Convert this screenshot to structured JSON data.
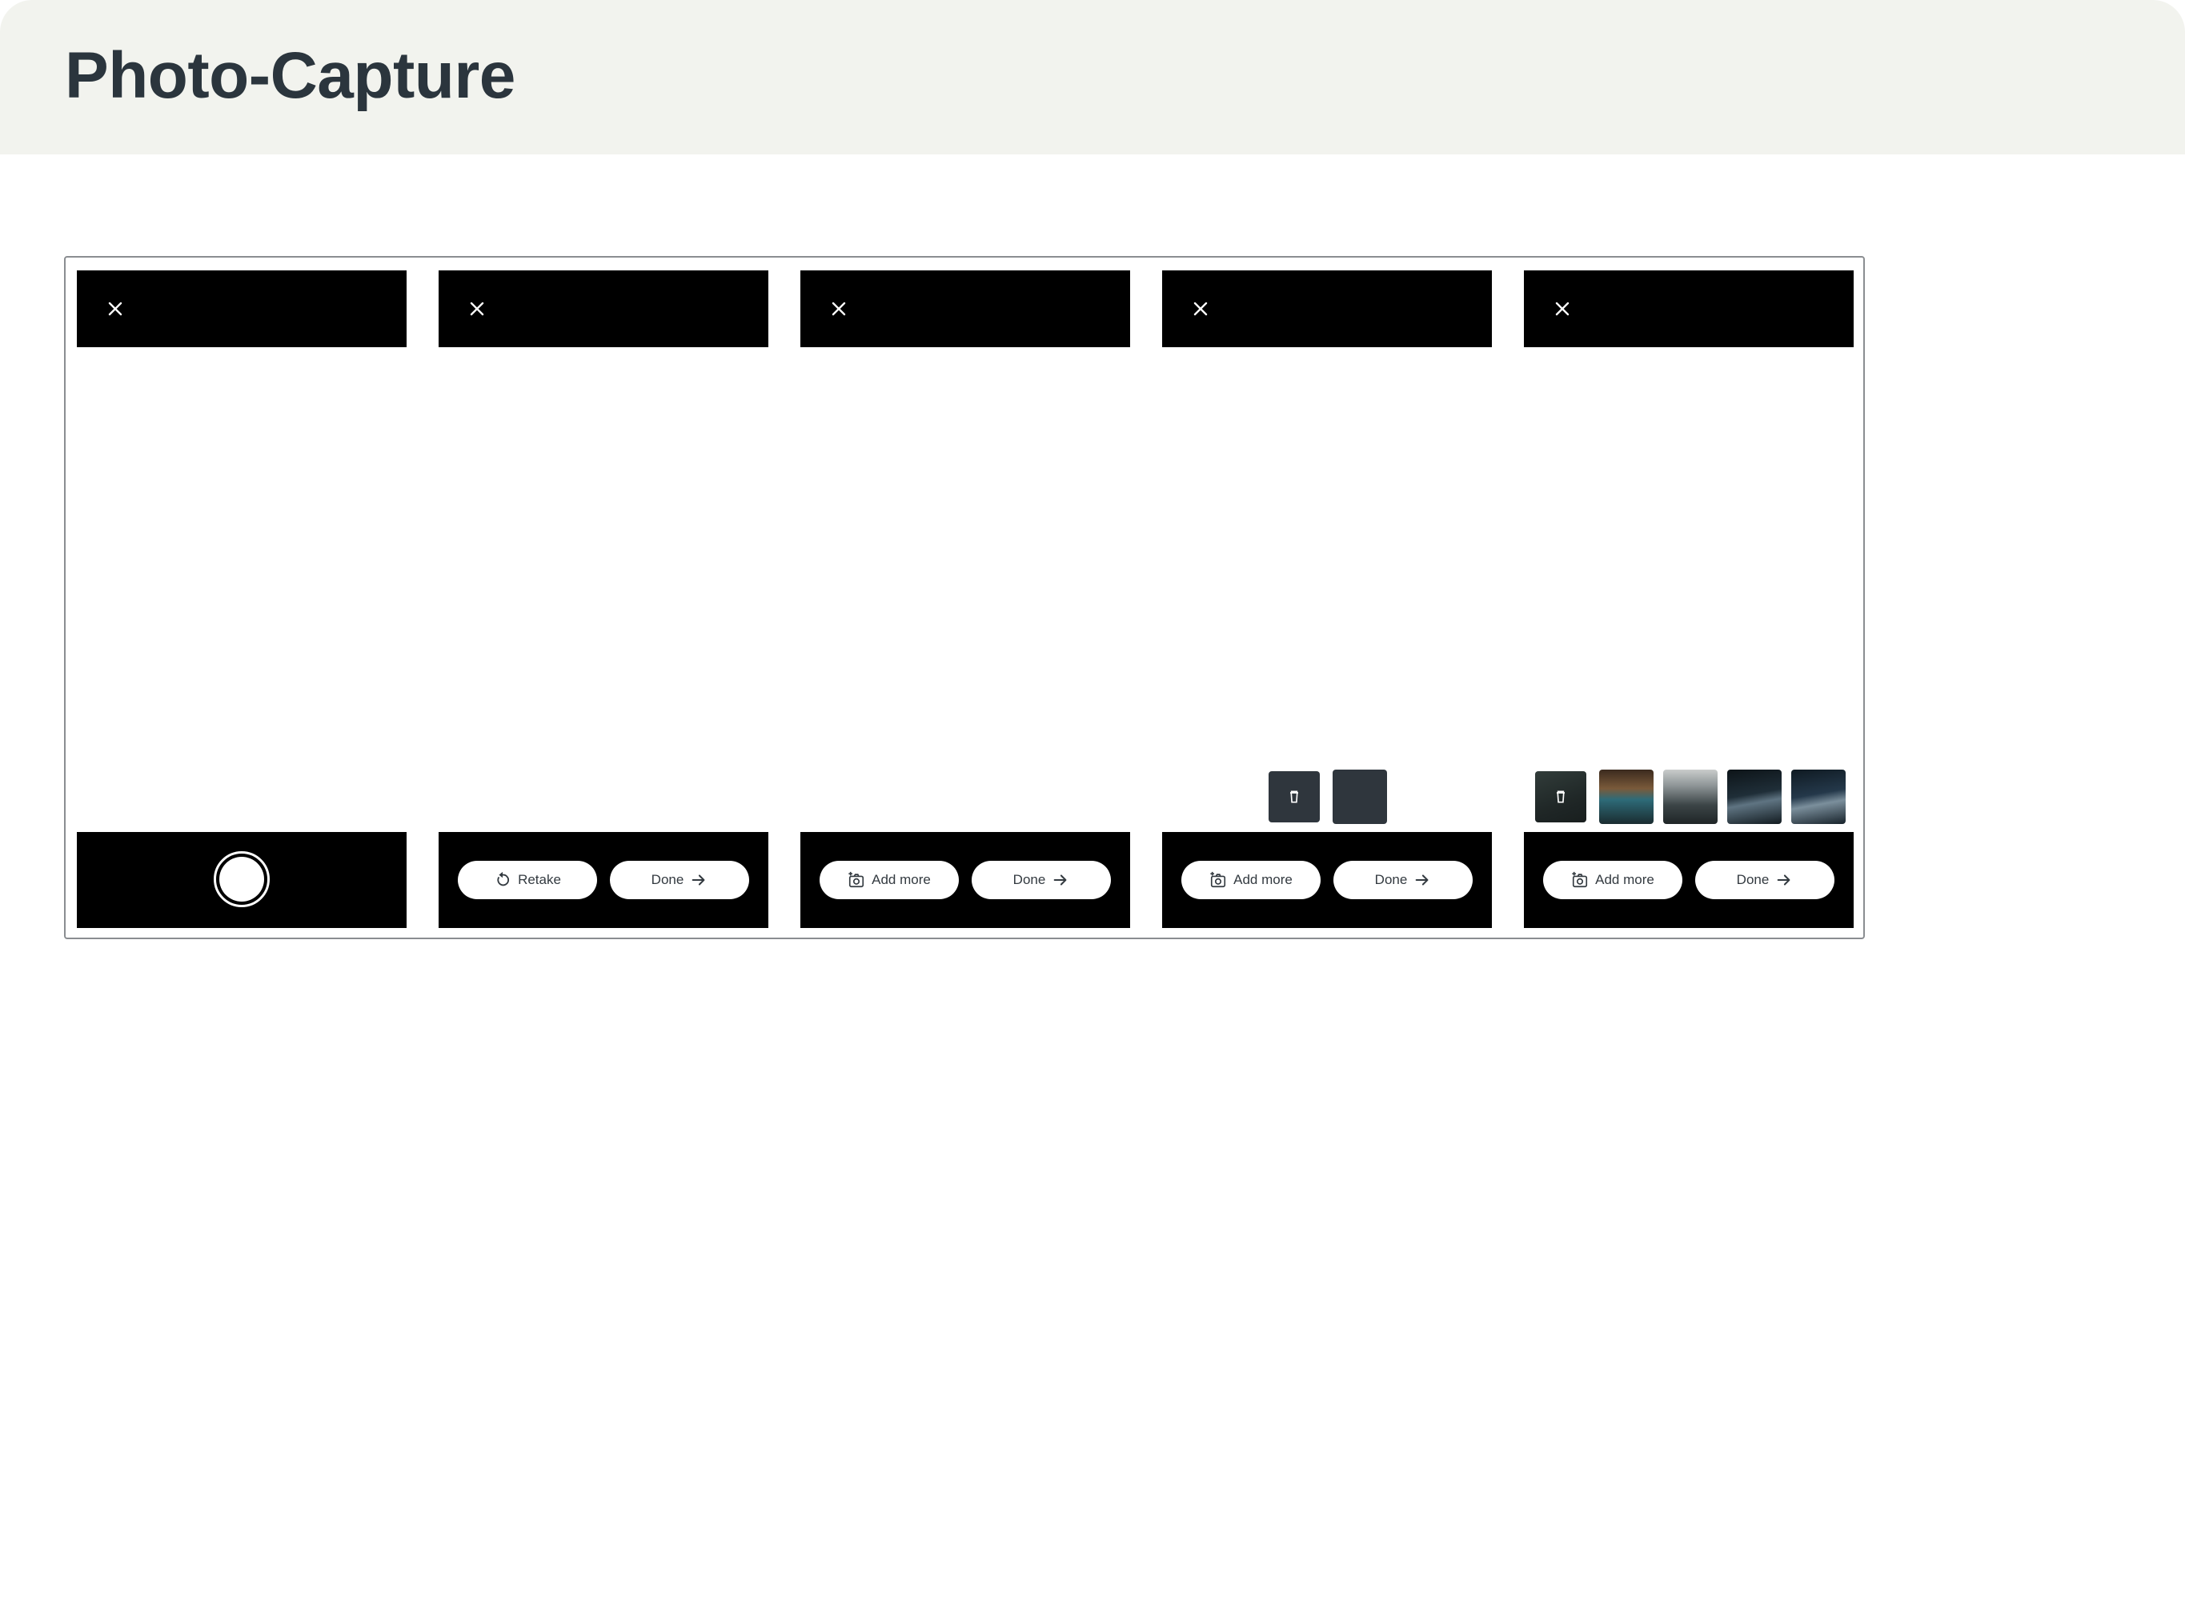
{
  "header": {
    "title": "Photo-Capture"
  },
  "colors": {
    "header_bg": "#f2f3ee",
    "bar_bg": "#000000",
    "pill_bg": "#ffffff",
    "thumb_placeholder": "#2f363d",
    "title_text": "#2b353d"
  },
  "screens": [
    {
      "close_icon": "close-icon",
      "control": "shutter-button"
    },
    {
      "close_icon": "close-icon",
      "left_label": "Retake",
      "left_icon": "retake-icon",
      "right_label": "Done",
      "right_icon": "arrow-right-icon"
    },
    {
      "close_icon": "close-icon",
      "left_label": "Add more",
      "left_icon": "add-photo-icon",
      "right_label": "Done",
      "right_icon": "arrow-right-icon"
    },
    {
      "close_icon": "close-icon",
      "left_label": "Add more",
      "left_icon": "add-photo-icon",
      "right_label": "Done",
      "right_icon": "arrow-right-icon",
      "thumbnails": [
        "selected-with-delete",
        "placeholder"
      ]
    },
    {
      "close_icon": "close-icon",
      "left_label": "Add more",
      "left_icon": "add-photo-icon",
      "right_label": "Done",
      "right_icon": "arrow-right-icon",
      "thumbnails": [
        "selected-with-delete",
        "car-photo-1",
        "car-photo-2",
        "car-photo-3",
        "car-photo-4"
      ]
    }
  ]
}
